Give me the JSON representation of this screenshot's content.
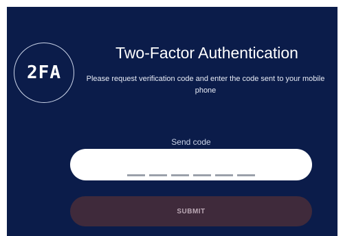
{
  "badge": {
    "label": "2FA"
  },
  "header": {
    "title": "Two-Factor Authentication",
    "subtitle": "Please request verification code and enter the code sent to your mobile phone"
  },
  "form": {
    "send_code_label": "Send code",
    "code_slots": 6,
    "submit_label": "SUBMIT"
  },
  "colors": {
    "background": "#0b1c4a",
    "submit_button": "#3f2a3b",
    "input_background": "#ffffff"
  }
}
